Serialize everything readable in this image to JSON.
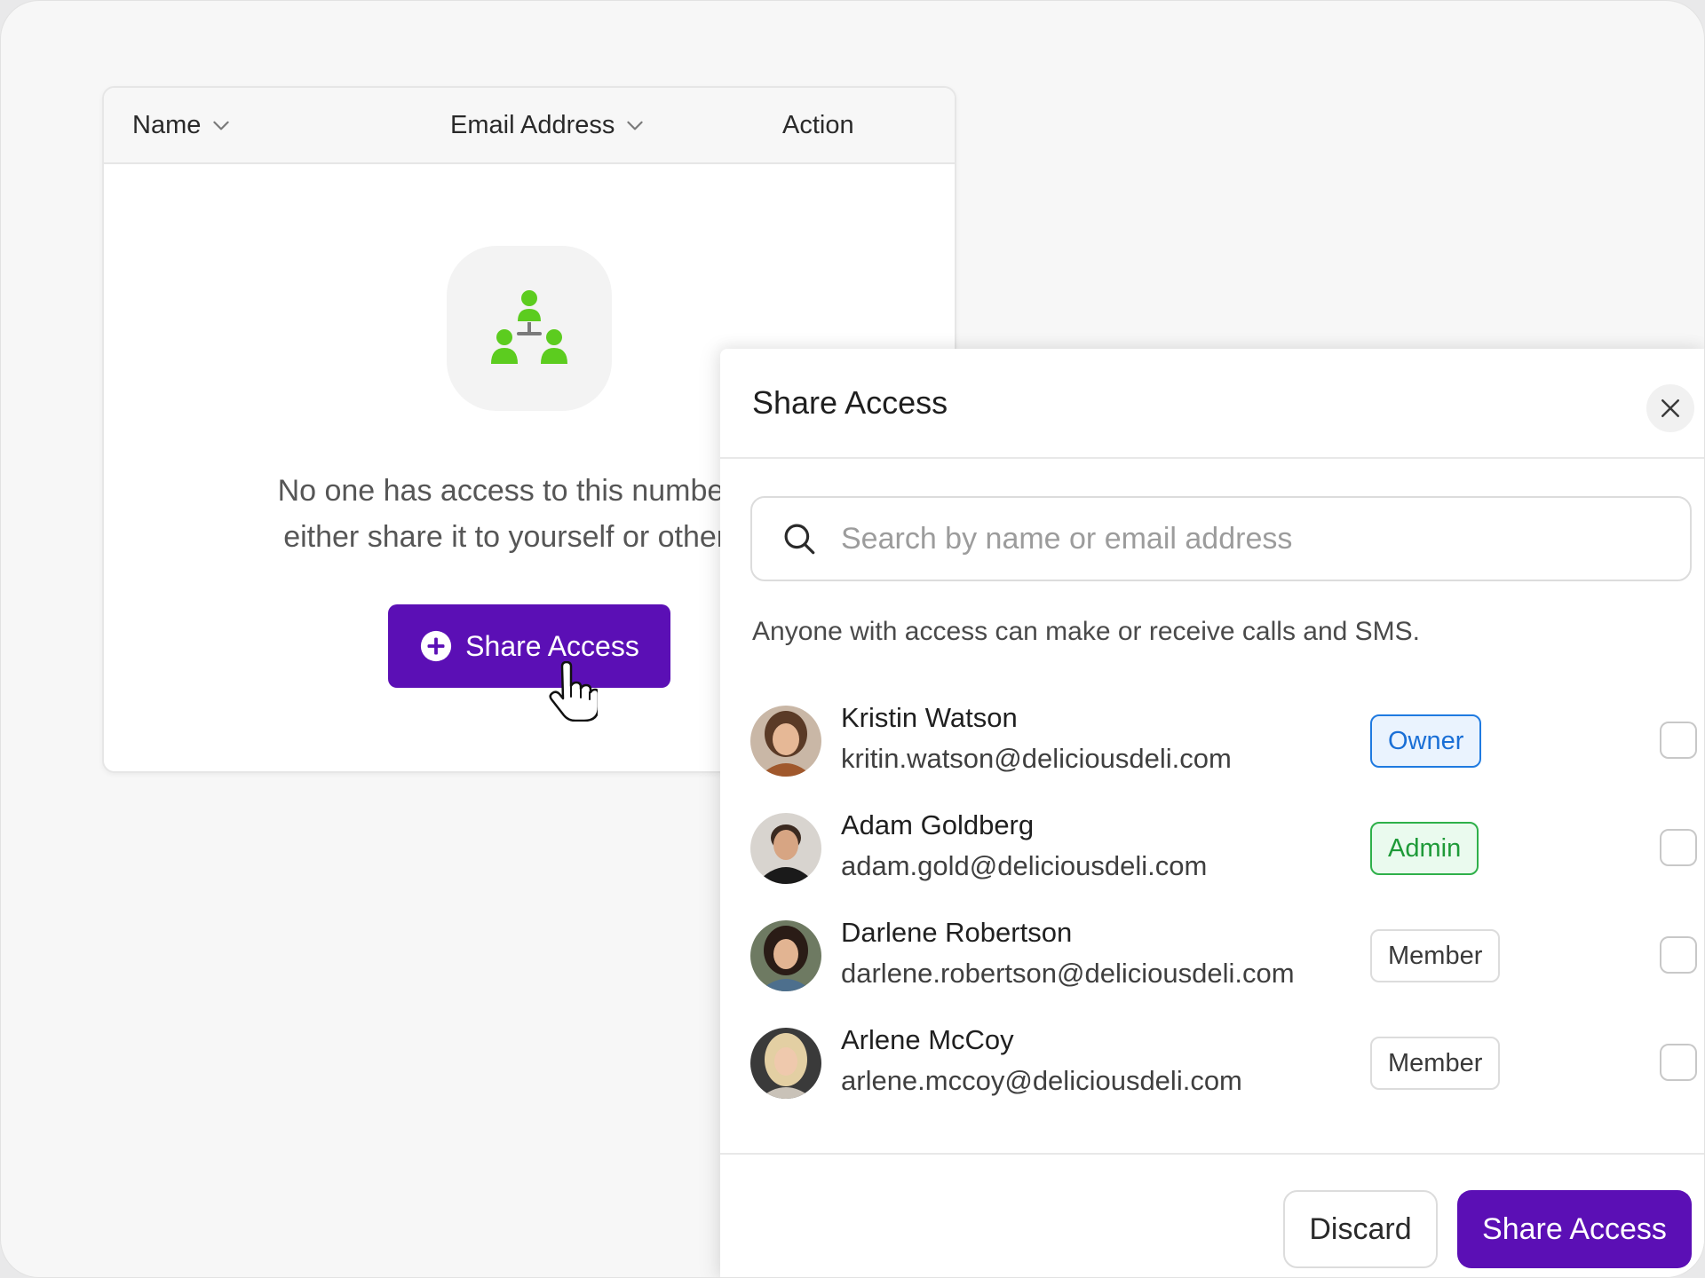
{
  "table": {
    "columns": {
      "name": "Name",
      "email": "Email Address",
      "action": "Action"
    },
    "empty_state": {
      "line1": "No one has access to this number yet",
      "line2": "either share it to yourself or other me",
      "button_label": "Share Access"
    }
  },
  "panel": {
    "title": "Share Access",
    "search_placeholder": "Search by name or email address",
    "info": "Anyone with access can make or receive calls and SMS.",
    "users": [
      {
        "name": "Kristin Watson",
        "email": "kritin.watson@deliciousdeli.com",
        "role": "Owner"
      },
      {
        "name": "Adam Goldberg",
        "email": "adam.gold@deliciousdeli.com",
        "role": "Admin"
      },
      {
        "name": "Darlene Robertson",
        "email": "darlene.robertson@deliciousdeli.com",
        "role": "Member"
      },
      {
        "name": "Arlene McCoy",
        "email": "arlene.mccoy@deliciousdeli.com",
        "role": "Member"
      }
    ],
    "footer": {
      "discard_label": "Discard",
      "share_label": "Share Access"
    }
  },
  "colors": {
    "primary": "#5b0fb5",
    "owner_badge": "#1a6fd6",
    "admin_badge": "#1e9a38",
    "empty_icon": "#5ccc1f"
  }
}
